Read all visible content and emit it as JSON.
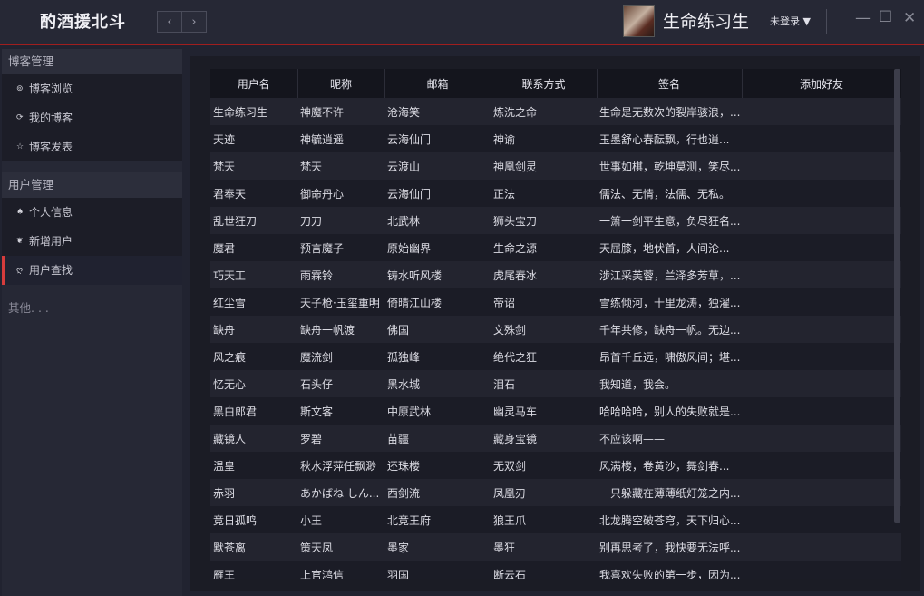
{
  "app": {
    "title": "酌酒援北斗"
  },
  "header": {
    "username": "生命练习生",
    "login_status": "未登录 ▼",
    "nav_prev": "‹",
    "nav_next": "›",
    "minimize": "—",
    "maximize": "☐",
    "close": "✕"
  },
  "sidebar": {
    "sections": [
      {
        "title": "博客管理",
        "items": [
          {
            "icon": "blog-browse-icon",
            "glyph": "⊚",
            "label": "博客浏览"
          },
          {
            "icon": "my-blog-icon",
            "glyph": "⟳",
            "label": "我的博客"
          },
          {
            "icon": "star-icon",
            "glyph": "☆",
            "label": "博客发表"
          }
        ]
      },
      {
        "title": "用户管理",
        "items": [
          {
            "icon": "user-icon",
            "glyph": "♠",
            "label": "个人信息"
          },
          {
            "icon": "add-user-icon",
            "glyph": "❦",
            "label": "新增用户"
          },
          {
            "icon": "user-search-icon",
            "glyph": "ღ",
            "label": "用户查找",
            "active": true
          }
        ]
      }
    ],
    "other": "其他. . ."
  },
  "table": {
    "columns": [
      "用户名",
      "昵称",
      "邮箱",
      "联系方式",
      "签名",
      "添加好友"
    ],
    "rows": [
      [
        "生命练习生",
        "神魔不许",
        "沧海笑",
        "炼洗之命",
        "生命是无数次的裂岸骇浪，...",
        ""
      ],
      [
        "天迹",
        "神毓逍遥",
        "云海仙门",
        "神谕",
        "玉墨舒心春酝飘，行也逍...",
        ""
      ],
      [
        "梵天",
        "梵天",
        "云渡山",
        "神凰剑灵",
        "世事如棋，乾坤莫测，笑尽...",
        ""
      ],
      [
        "君奉天",
        "御命丹心",
        "云海仙门",
        "正法",
        "儒法、无情，法儒、无私。",
        ""
      ],
      [
        "乱世狂刀",
        "刀刀",
        "北武林",
        "狮头宝刀",
        "一箫一剑平生意，负尽狂名...",
        ""
      ],
      [
        "魔君",
        "预言魔子",
        "原始幽界",
        "生命之源",
        "天屈膝，地伏首，人间沦...",
        ""
      ],
      [
        "巧天工",
        "雨霖铃",
        "铸水听风楼",
        "虎尾春冰",
        "涉江采芙蓉，兰泽多芳草，...",
        ""
      ],
      [
        "红尘雪",
        "天子枪·玉玺重明",
        "倚晴江山楼",
        "帝诏",
        "雪练倾河，十里龙涛，独濯...",
        ""
      ],
      [
        "缺舟",
        "缺舟一帆渡",
        "佛国",
        "文殊剑",
        "千年共修，缺舟一帆。无边...",
        ""
      ],
      [
        "风之痕",
        "魔流剑",
        "孤独峰",
        "绝代之狂",
        "昂首千丘远，啸傲风间；堪...",
        ""
      ],
      [
        "忆无心",
        "石头仔",
        "黑水城",
        "泪石",
        "我知道，我会。",
        ""
      ],
      [
        "黑白郎君",
        "斯文客",
        "中原武林",
        "幽灵马车",
        "哈哈哈哈，别人的失败就是...",
        ""
      ],
      [
        "藏镜人",
        "罗碧",
        "苗疆",
        "藏身宝镜",
        "不应该啊——",
        ""
      ],
      [
        "温皇",
        "秋水浮萍任飘渺",
        "还珠楼",
        "无双剑",
        "风满楼，卷黄沙，舞剑春...",
        ""
      ],
      [
        "赤羽",
        "あかばね しん...",
        "西剑流",
        "凤凰刃",
        "一只躲藏在薄薄纸灯笼之内...",
        ""
      ],
      [
        "竞日孤鸣",
        "小王",
        "北竞王府",
        "狼王爪",
        "北龙腾空破苍穹，天下归心...",
        ""
      ],
      [
        "默苍离",
        "策天凤",
        "墨家",
        "墨狂",
        "别再思考了，我快要无法呼...",
        ""
      ],
      [
        "雁王",
        "上官鸿信",
        "羽国",
        "断云石",
        "我喜欢失败的第一步，因为...",
        ""
      ]
    ]
  }
}
